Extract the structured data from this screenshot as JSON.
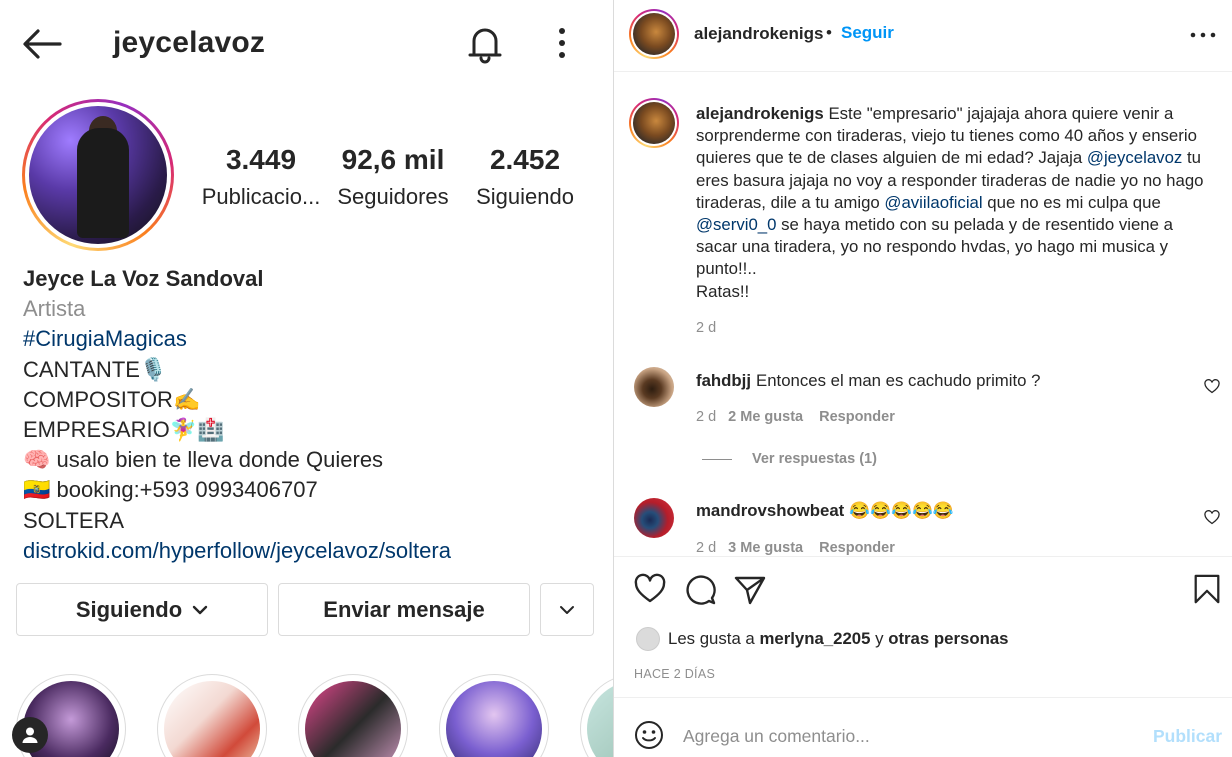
{
  "profile": {
    "username": "jeycelavoz",
    "stats": {
      "posts": {
        "value": "3.449",
        "label": "Publicacio..."
      },
      "followers": {
        "value": "92,6 mil",
        "label": "Seguidores"
      },
      "following": {
        "value": "2.452",
        "label": "Siguiendo"
      }
    },
    "bio": {
      "name": "Jeyce La Voz Sandoval",
      "category": "Artista",
      "hashtag": "#CirugiaMagicas",
      "lines": [
        "CANTANTE🎙️",
        "COMPOSITOR✍️",
        "EMPRESARIO🧚‍♀️🏥",
        "🧠 usalo bien te lleva donde Quieres",
        "🇪🇨 booking:+593 0993406707",
        "SOLTERA"
      ],
      "link": "distrokid.com/hyperfollow/jeycelavoz/soltera"
    },
    "buttons": {
      "following": "Siguiendo",
      "message": "Enviar mensaje"
    },
    "highlights_count": 5
  },
  "post": {
    "author": "alejandrokenigs",
    "dot": "•",
    "follow_label": "Seguir",
    "caption": {
      "user": "alejandrokenigs",
      "part1": "Este \"empresario\" jajajaja ahora quiere venir a sorprenderme con tiraderas, viejo tu tienes como 40 años y enserio quieres que te de clases alguien de mi edad? Jajaja ",
      "mention1": "@jeycelavoz",
      "part2": " tu eres basura jajaja no voy a responder tiraderas de nadie yo no hago tiraderas, dile a tu amigo ",
      "mention2": "@aviilaoficial",
      "part3": " que no es mi culpa que ",
      "mention3": "@servi0_0",
      "part4": " se haya metido con su pelada y de resentido viene a sacar una tiradera, yo no respondo hvdas, yo hago mi musica y punto!!..",
      "part5": "Ratas!!",
      "time": "2 d"
    },
    "comments": [
      {
        "user": "fahdbjj",
        "text": "Entonces el man es cachudo primito ?",
        "time": "2 d",
        "likes": "2 Me gusta",
        "reply": "Responder"
      },
      {
        "user": "mandrovshowbeat",
        "text": "😂😂😂😂😂",
        "time": "2 d",
        "likes": "3 Me gusta",
        "reply": "Responder"
      }
    ],
    "view_replies": "Ver respuestas (1)",
    "likes": {
      "prefix": "Les gusta a ",
      "user": "merlyna_2205",
      "mid": " y ",
      "rest": "otras personas"
    },
    "time_ago": "HACE 2 DÍAS",
    "comment_placeholder": "Agrega un comentario...",
    "publish_label": "Publicar"
  },
  "colors": {
    "accent_blue": "#0095f6",
    "link_blue": "#00376b",
    "text": "#262626",
    "muted": "#8e8e8e",
    "border": "#dbdbdb",
    "publish_disabled": "#b2dffc"
  }
}
